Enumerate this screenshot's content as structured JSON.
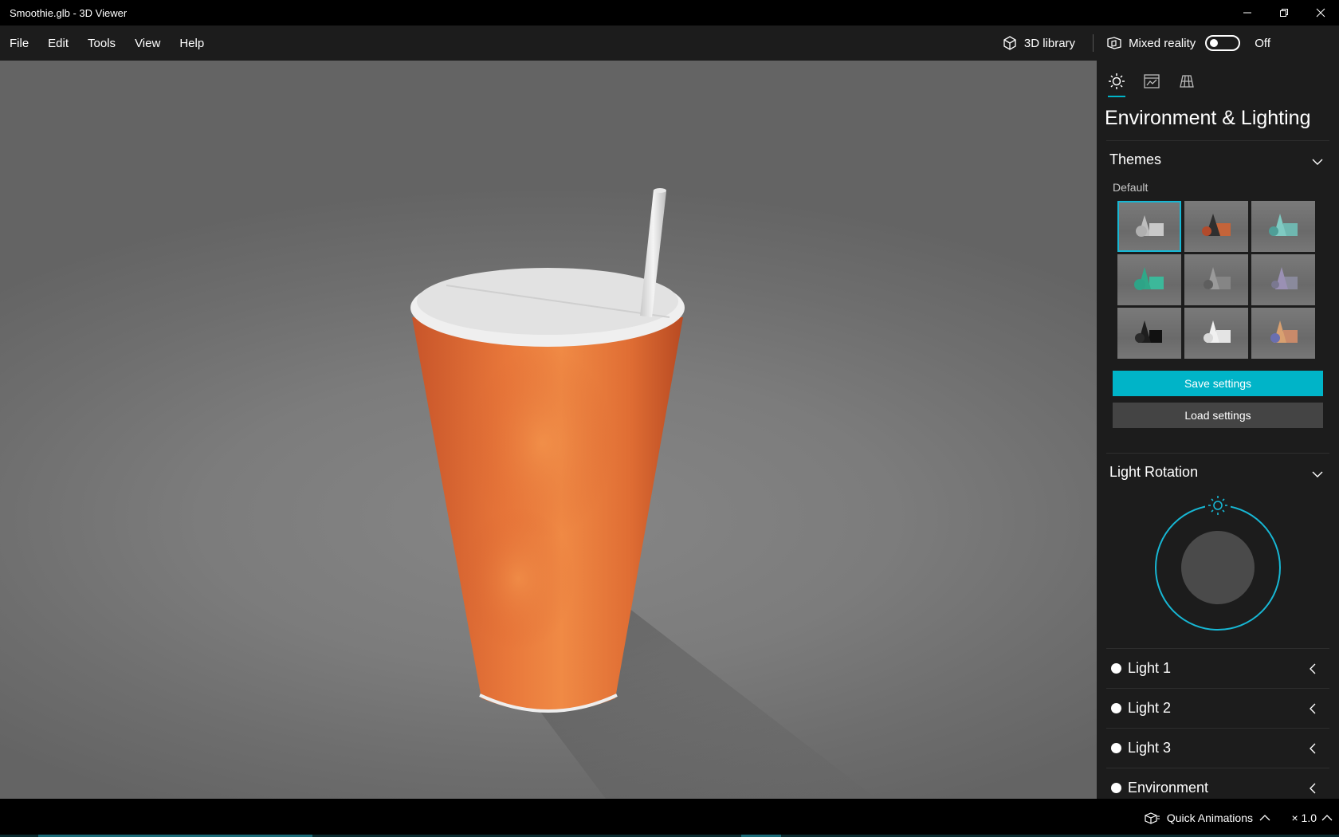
{
  "window": {
    "title": "Smoothie.glb - 3D Viewer",
    "controls": [
      "minimize-icon",
      "restore-icon",
      "close-icon"
    ]
  },
  "menu": {
    "items": [
      "File",
      "Edit",
      "Tools",
      "View",
      "Help"
    ],
    "library_label": "3D library",
    "mixed_reality_label": "Mixed reality",
    "toggle_state": "Off"
  },
  "viewport": {
    "model": "smoothie-cup",
    "colors": {
      "cup": "#e8773a",
      "lid": "#e6e6e6",
      "background": "#7a7a7a"
    }
  },
  "panel": {
    "tabs": [
      {
        "icon": "sun-icon",
        "active": true
      },
      {
        "icon": "stats-icon",
        "active": false
      },
      {
        "icon": "grid-icon",
        "active": false
      }
    ],
    "title": "Environment & Lighting",
    "themes": {
      "heading": "Themes",
      "subheading": "Default",
      "selected_index": 0,
      "count": 9
    },
    "save_label": "Save settings",
    "load_label": "Load settings",
    "light_rotation": {
      "heading": "Light Rotation"
    },
    "lights": [
      {
        "label": "Light 1"
      },
      {
        "label": "Light 2"
      },
      {
        "label": "Light 3"
      },
      {
        "label": "Environment"
      }
    ],
    "accent": "#00b4c8"
  },
  "status": {
    "quick_animations": "Quick Animations",
    "speed": "× 1.0"
  }
}
